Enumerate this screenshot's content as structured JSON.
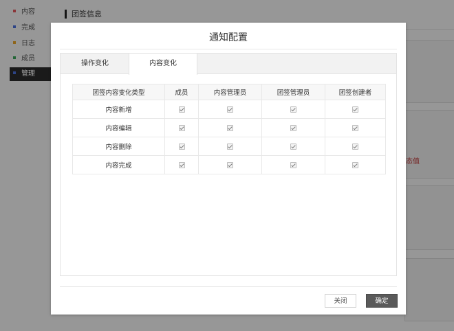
{
  "sidebar": {
    "items": [
      {
        "label": "内容",
        "dot_color": "#e0565b"
      },
      {
        "label": "完成",
        "dot_color": "#4a6fd8"
      },
      {
        "label": "日志",
        "dot_color": "#e5a32b"
      },
      {
        "label": "成员",
        "dot_color": "#3aa55a"
      },
      {
        "label": "管理",
        "dot_color": "#4a6fd8",
        "active": true
      }
    ]
  },
  "page": {
    "title": "团签信息",
    "partial_red_text": "态值"
  },
  "modal": {
    "title": "通知配置",
    "tabs": [
      {
        "label": "操作变化",
        "active": false
      },
      {
        "label": "内容变化",
        "active": true
      }
    ],
    "table": {
      "headers": [
        "团签内容变化类型",
        "成员",
        "内容管理员",
        "团签管理员",
        "团签创建者"
      ],
      "rows": [
        {
          "label": "内容新增",
          "checks": [
            true,
            true,
            true,
            true
          ]
        },
        {
          "label": "内容编辑",
          "checks": [
            true,
            true,
            true,
            true
          ]
        },
        {
          "label": "内容删除",
          "checks": [
            true,
            true,
            true,
            true
          ]
        },
        {
          "label": "内容完成",
          "checks": [
            true,
            true,
            true,
            true
          ]
        }
      ]
    },
    "buttons": {
      "close": "关闭",
      "confirm": "确定"
    }
  }
}
